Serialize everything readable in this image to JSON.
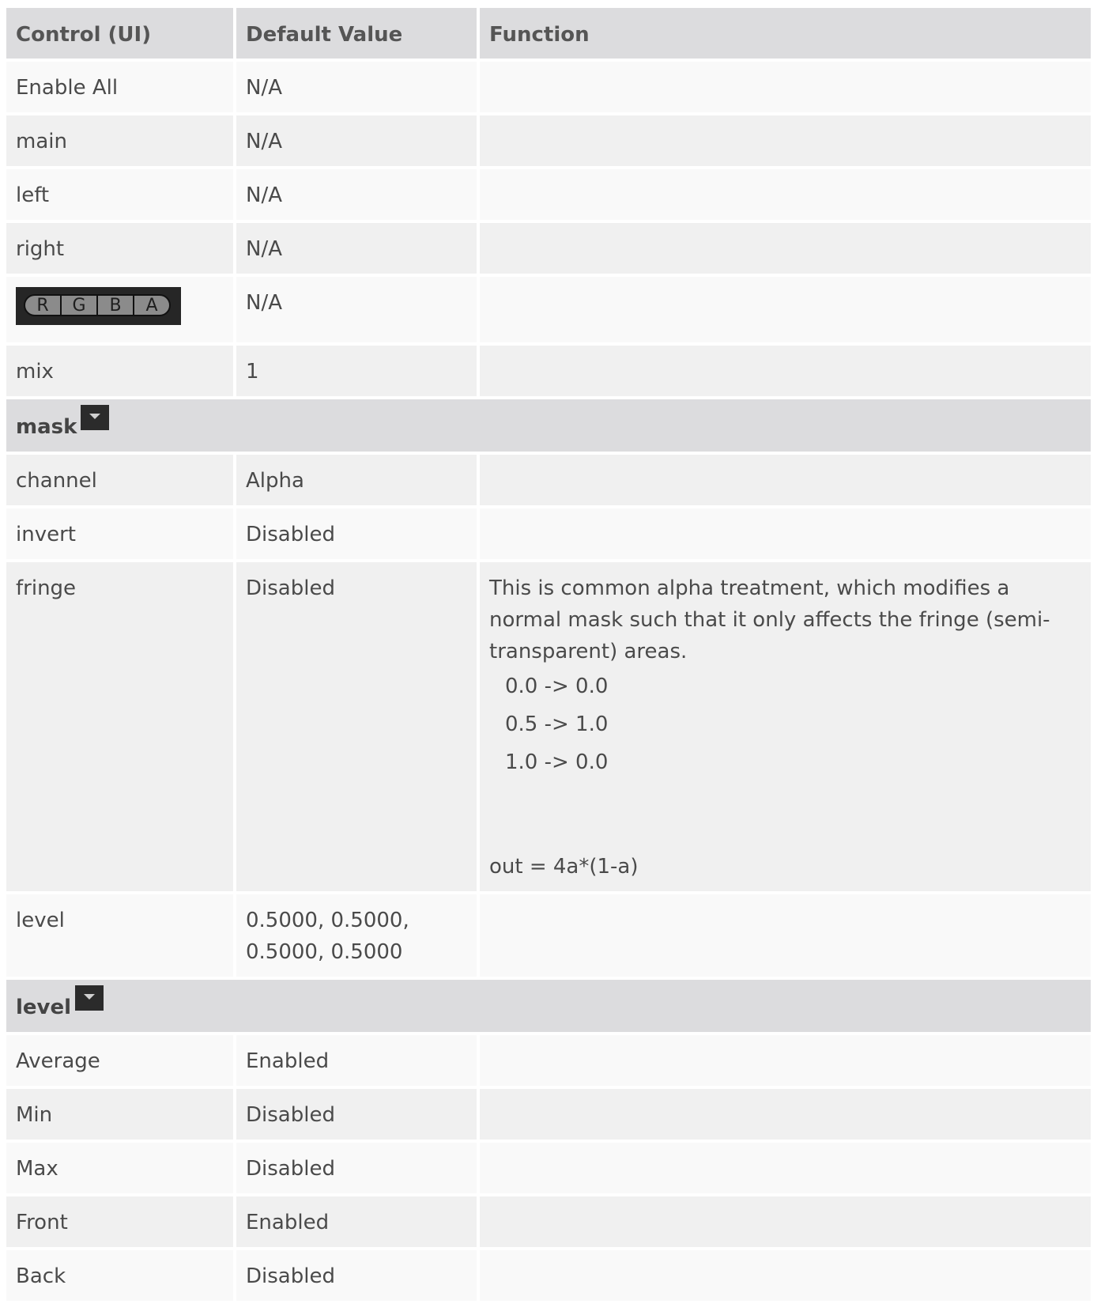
{
  "headers": {
    "control": "Control (UI)",
    "default": "Default Value",
    "function": "Function"
  },
  "rows": [
    {
      "control": "Enable All",
      "default": "N/A"
    },
    {
      "control": "main",
      "default": "N/A"
    },
    {
      "control": "left",
      "default": "N/A"
    },
    {
      "control": "right",
      "default": "N/A"
    },
    {
      "control_widget": {
        "letters": [
          "R",
          "G",
          "B",
          "A"
        ]
      },
      "default": "N/A"
    },
    {
      "control": "mix",
      "default": "1"
    }
  ],
  "section_mask": {
    "label": "mask"
  },
  "mask_rows": [
    {
      "control": "channel",
      "default": "Alpha"
    },
    {
      "control": "invert",
      "default": "Disabled"
    },
    {
      "control": "fringe",
      "default": "Disabled",
      "function_intro": "This is common alpha treatment, which modifies a normal mask such that it only affects the fringe (semi-transparent) areas.",
      "function_map": [
        "0.0 -> 0.0",
        "0.5 -> 1.0",
        "1.0 -> 0.0"
      ],
      "function_formula": "out = 4a*(1-a)"
    },
    {
      "control": "level",
      "default_line1": "0.5000, 0.5000,",
      "default_line2": "0.5000, 0.5000"
    }
  ],
  "section_level": {
    "label": "level"
  },
  "level_rows": [
    {
      "control": "Average",
      "default": "Enabled"
    },
    {
      "control": "Min",
      "default": "Disabled"
    },
    {
      "control": "Max",
      "default": "Disabled"
    },
    {
      "control": "Front",
      "default": "Enabled"
    },
    {
      "control": "Back",
      "default": "Disabled"
    }
  ]
}
